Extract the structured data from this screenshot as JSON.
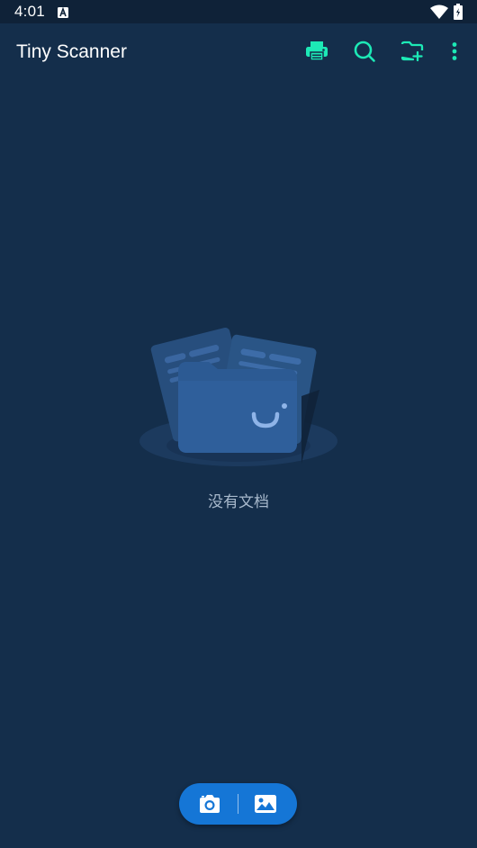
{
  "status_bar": {
    "time": "4:01",
    "notification_icon": "a-notification-icon",
    "wifi_icon": "wifi-icon",
    "battery_icon": "battery-icon"
  },
  "app_bar": {
    "title": "Tiny Scanner",
    "actions": [
      {
        "icon": "print-icon"
      },
      {
        "icon": "search-icon"
      },
      {
        "icon": "new-folder-icon"
      },
      {
        "icon": "more-vert-icon"
      }
    ],
    "accent_color": "#1de9b6"
  },
  "empty_state": {
    "message": "没有文档",
    "illustration_icon": "empty-folder-illustration"
  },
  "fab": {
    "camera_icon": "camera-icon",
    "gallery_icon": "image-icon",
    "color": "#1576d6"
  },
  "colors": {
    "background": "#142e4b",
    "status_bar": "#0f2238"
  }
}
